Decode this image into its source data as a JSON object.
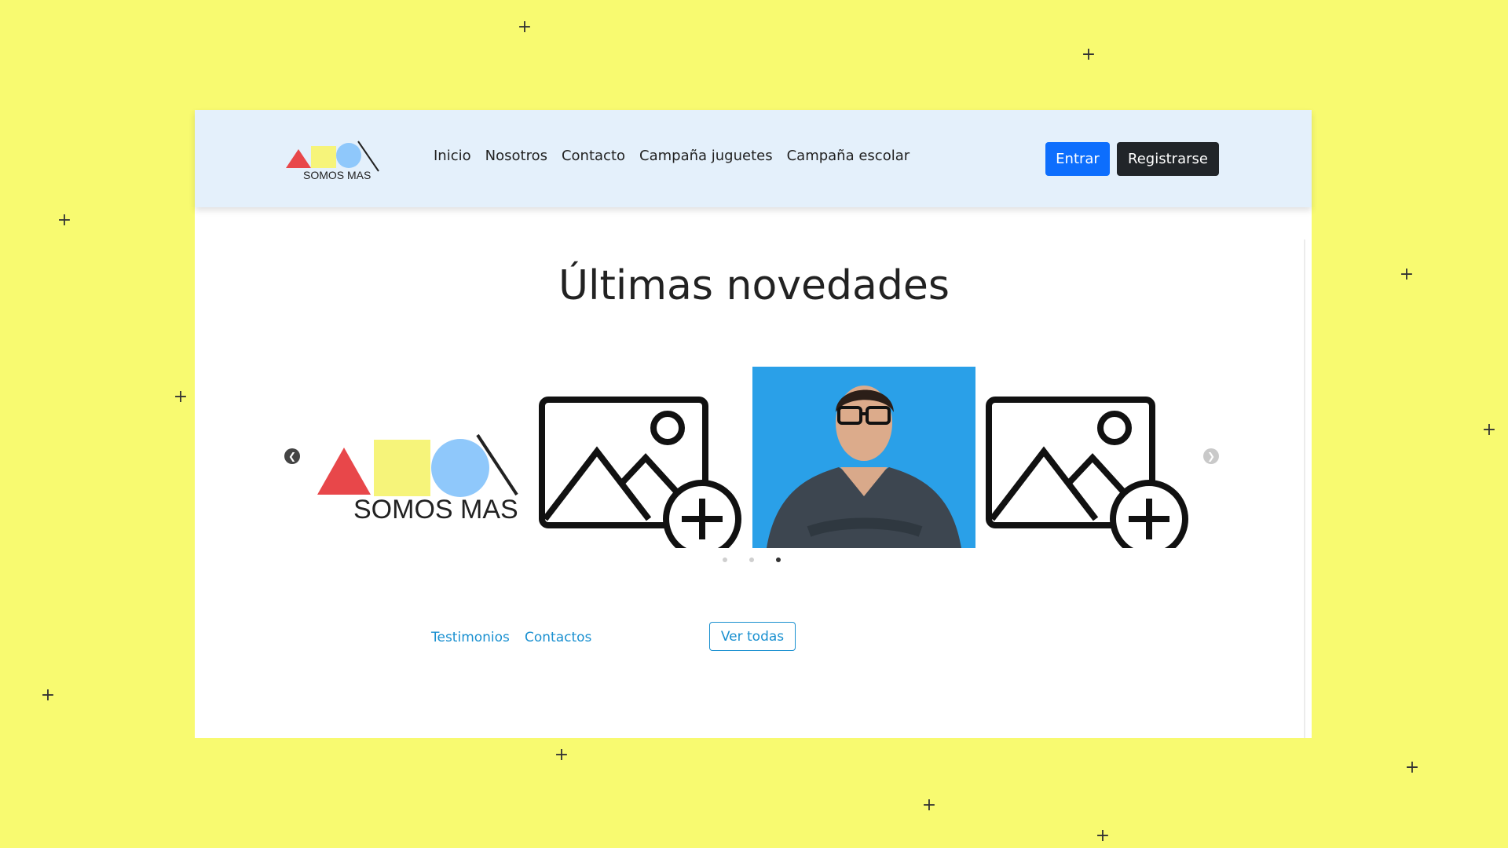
{
  "brand": {
    "logo_text": "SOMOS MAS",
    "colors": {
      "red": "#e8474a",
      "yellow": "#f6f47a",
      "blue": "#8fc8fb"
    }
  },
  "nav": {
    "links": [
      "Inicio",
      "Nosotros",
      "Contacto",
      "Campaña juguetes",
      "Campaña escolar"
    ],
    "login_label": "Entrar",
    "register_label": "Registrarse"
  },
  "main": {
    "title": "Últimas novedades",
    "carousel": {
      "slides": [
        "logo-image",
        "image-placeholder-icon",
        "person-photo",
        "image-placeholder-icon"
      ],
      "dots": 3,
      "active_dot": 3
    }
  },
  "footer": {
    "links": [
      "Testimonios",
      "Contactos"
    ],
    "view_all_label": "Ver todas"
  },
  "theme": {
    "page_bg": "#f8fa70",
    "nav_bg": "#e4f0fb",
    "primary": "#0d6efd",
    "dark": "#212529",
    "link": "#1a90d0"
  }
}
